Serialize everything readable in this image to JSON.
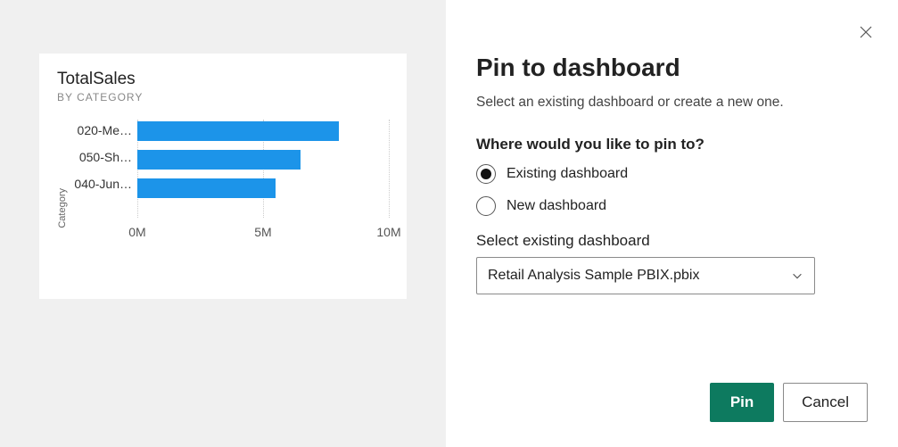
{
  "chart": {
    "title": "TotalSales",
    "subtitle": "BY CATEGORY",
    "y_axis_label": "Category",
    "categories": [
      "020-Me…",
      "050-Sh…",
      "040-Jun…"
    ],
    "x_ticks": [
      "0M",
      "5M",
      "10M"
    ]
  },
  "chart_data": {
    "type": "bar",
    "orientation": "horizontal",
    "title": "TotalSales",
    "subtitle": "BY CATEGORY",
    "xlabel": "",
    "ylabel": "Category",
    "xlim": [
      0,
      10000000
    ],
    "categories": [
      "020-Me…",
      "050-Sh…",
      "040-Jun…"
    ],
    "values": [
      8000000,
      6500000,
      5500000
    ],
    "x_ticks": [
      0,
      5000000,
      10000000
    ],
    "x_tick_labels": [
      "0M",
      "5M",
      "10M"
    ]
  },
  "dialog": {
    "title": "Pin to dashboard",
    "subtitle": "Select an existing dashboard or create a new one.",
    "where_heading": "Where would you like to pin to?",
    "option_existing": "Existing dashboard",
    "option_new": "New dashboard",
    "select_label": "Select existing dashboard",
    "select_value": "Retail Analysis Sample PBIX.pbix",
    "pin_label": "Pin",
    "cancel_label": "Cancel"
  }
}
